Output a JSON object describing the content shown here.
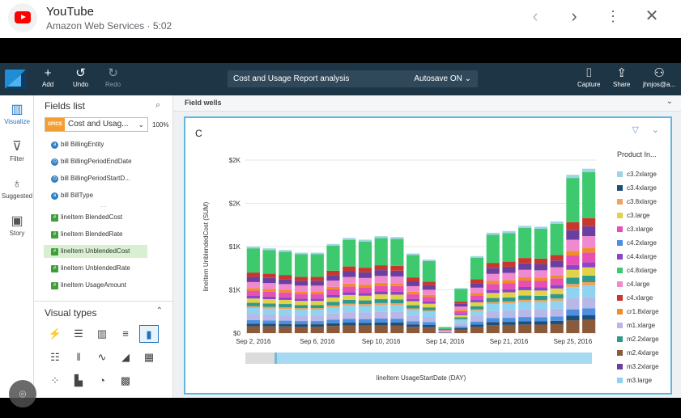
{
  "youtube": {
    "title": "YouTube",
    "subtitle": "Amazon Web Services · 5:02"
  },
  "toolbar": {
    "add": "Add",
    "undo": "Undo",
    "redo": "Redo",
    "analysis": "Cost and Usage Report analysis",
    "autosave": "Autosave ON",
    "capture": "Capture",
    "share": "Share",
    "user": "jhnjos@a..."
  },
  "rail": [
    "Visualize",
    "Filter",
    "Suggested",
    "Story"
  ],
  "fields": {
    "header": "Fields list",
    "spice": "SPICE",
    "dataset": "Cost and Usag...",
    "percent": "100%",
    "items": [
      {
        "label": "bill BillingEntity",
        "type": "text"
      },
      {
        "label": "bill BillingPeriodEndDate",
        "type": "date"
      },
      {
        "label": "bill BillingPeriodStartD...",
        "type": "date"
      },
      {
        "label": "bill BillType",
        "type": "text"
      },
      {
        "label": "lineItem BlendedCost",
        "type": "num"
      },
      {
        "label": "lineItem BlendedRate",
        "type": "num"
      },
      {
        "label": "lineItem UnblendedCost",
        "type": "num"
      },
      {
        "label": "lineItem UnblendedRate",
        "type": "num"
      },
      {
        "label": "lineItem UsageAmount",
        "type": "num"
      }
    ]
  },
  "visual_types": {
    "header": "Visual types"
  },
  "field_wells": "Field wells",
  "visual": {
    "title": "C"
  },
  "chart_data": {
    "type": "bar",
    "stacked": true,
    "xlabel": "lineItem UsageStartDate (DAY)",
    "ylabel": "lineItem UnblendedCost (SUM)",
    "yticks": [
      "$0",
      "$1K",
      "$1K",
      "$2K",
      "$2K"
    ],
    "ylim": [
      0,
      2000
    ],
    "xticks": [
      "Sep 2, 2016",
      "Sep 6, 2016",
      "Sep 10, 2016",
      "Sep 14, 2016",
      "Sep 21, 2016",
      "Sep 25, 2016"
    ],
    "legend_title": "Product In...",
    "legend_placement": "right",
    "series": [
      {
        "name": "c3.2xlarge",
        "color": "#9fd3e6"
      },
      {
        "name": "c3.4xlarge",
        "color": "#1f4e79"
      },
      {
        "name": "c3.8xlarge",
        "color": "#f0a35e"
      },
      {
        "name": "c3.large",
        "color": "#e0d24a"
      },
      {
        "name": "c3.xlarge",
        "color": "#e64fb3"
      },
      {
        "name": "c4.2xlarge",
        "color": "#4d8fe0"
      },
      {
        "name": "c4.4xlarge",
        "color": "#8b45c8"
      },
      {
        "name": "c4.8xlarge",
        "color": "#3ec96e"
      },
      {
        "name": "c4.large",
        "color": "#f08ad0"
      },
      {
        "name": "c4.xlarge",
        "color": "#c8372d"
      },
      {
        "name": "cr1.8xlarge",
        "color": "#f28c28"
      },
      {
        "name": "m1.xlarge",
        "color": "#b7b7e8"
      },
      {
        "name": "m2.2xlarge",
        "color": "#2e9a8c"
      },
      {
        "name": "m2.4xlarge",
        "color": "#8a5a3b"
      },
      {
        "name": "m3.2xlarge",
        "color": "#6b3fa0"
      },
      {
        "name": "m3.large",
        "color": "#8fd3f0"
      }
    ],
    "totals": [
      1000,
      980,
      960,
      930,
      930,
      1030,
      1100,
      1080,
      1120,
      1110,
      920,
      850,
      80,
      520,
      890,
      1160,
      1180,
      1240,
      1230,
      1290,
      1830,
      1900
    ]
  }
}
